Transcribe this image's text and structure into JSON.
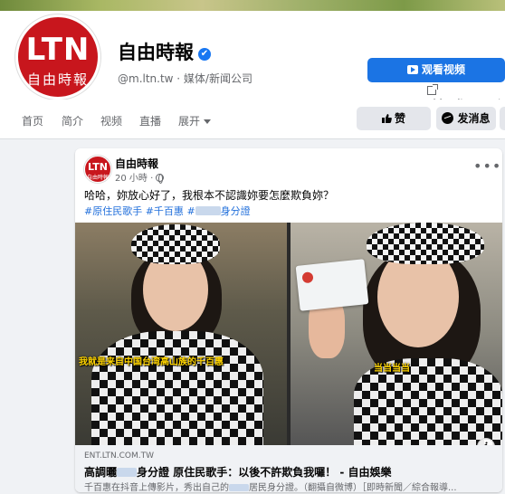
{
  "page": {
    "logo_line1": "LTN",
    "logo_line2": "自由時報",
    "name": "自由時報",
    "verified_mark": "✔",
    "subtitle": "@m.ltn.tw · 媒体/新闻公司",
    "watch_video_label": "观看视频",
    "external_link": "video.ltn.com.tw"
  },
  "nav": {
    "items": [
      "首页",
      "简介",
      "视频",
      "直播",
      "展开"
    ],
    "like_label": "赞",
    "message_label": "发消息"
  },
  "post": {
    "author": "自由時報",
    "avatar_line1": "LTN",
    "avatar_line2": "自由時報",
    "time": "20 小時 ·",
    "more_label": "•••",
    "text": "哈哈，妳放心好了，我根本不認識妳要怎麼欺負妳？",
    "hashtag1": "#原住民歌手",
    "hashtag2": "#千百惠",
    "hashtag3_prefix": "#",
    "hashtag3_suffix": "身分證",
    "caption_left": "我就是来自中国台湾高山族的千百惠",
    "caption_right": "当当当当",
    "link_domain": "ENT.LTN.COM.TW",
    "link_title_prefix": "高調曬",
    "link_title_suffix": "身分證 原住民歌手：以後不許欺負我囉！ - 自由娛樂",
    "link_desc_prefix": "千百惠在抖音上傳影片，秀出自己的",
    "link_desc_suffix": "居民身分證。（翻攝自微博）［即時新聞／綜合報導...",
    "info_label": "i"
  },
  "colors": {
    "brand_red": "#c8161d",
    "facebook_blue": "#1b74e4",
    "link_blue": "#216fdb",
    "caption_yellow": "#ffd400"
  }
}
